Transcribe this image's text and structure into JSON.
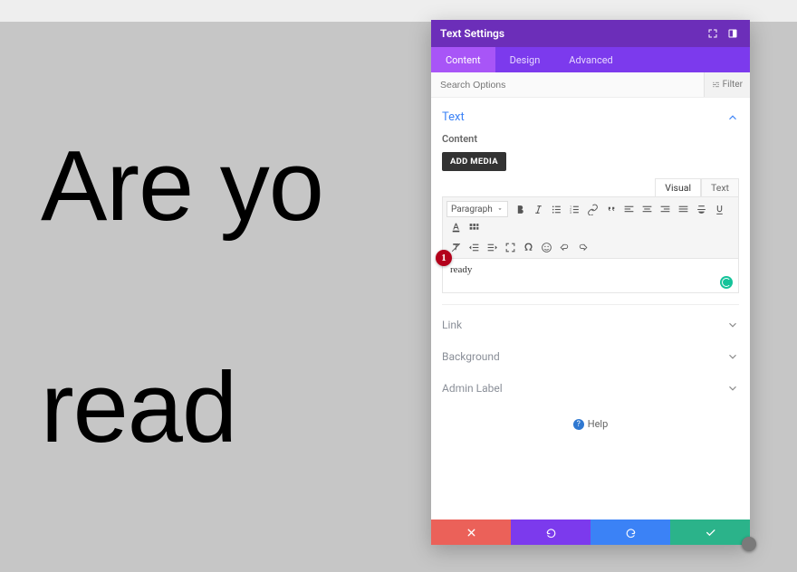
{
  "canvas": {
    "line1": "Are yo",
    "line2": "read"
  },
  "panel": {
    "title": "Text Settings",
    "tabs": {
      "content": "Content",
      "design": "Design",
      "advanced": "Advanced",
      "active": "content"
    },
    "search_placeholder": "Search Options",
    "filter_label": "Filter",
    "sections": {
      "text": {
        "title": "Text",
        "content_label": "Content",
        "add_media": "ADD MEDIA"
      },
      "link": {
        "title": "Link"
      },
      "background": {
        "title": "Background"
      },
      "admin_label": {
        "title": "Admin Label"
      }
    },
    "editor": {
      "modes": {
        "visual": "Visual",
        "text": "Text",
        "active": "visual"
      },
      "paragraph_label": "Paragraph",
      "content": "ready"
    },
    "help_label": "Help"
  },
  "annotation": {
    "num": "1"
  }
}
